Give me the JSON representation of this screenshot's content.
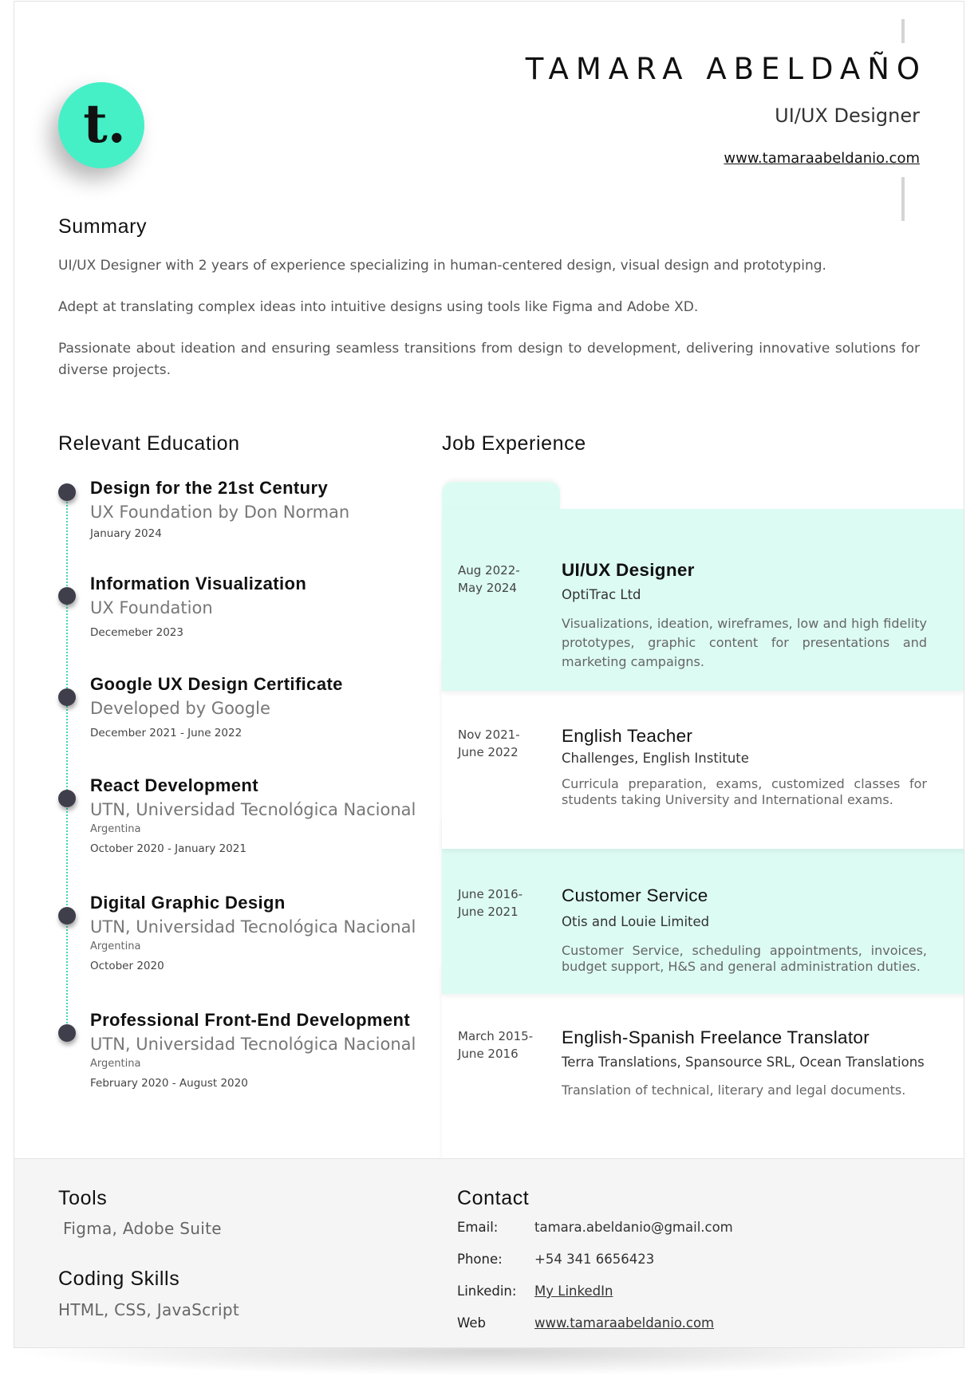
{
  "header": {
    "logo_letter": "t.",
    "name": "TAMARA ABELDAÑO",
    "role": "UI/UX Designer",
    "website": "www.tamaraabeldanio.com"
  },
  "summary": {
    "title": "Summary",
    "paragraphs": [
      "UI/UX Designer with 2 years of experience specializing in human-centered design, visual design and prototyping.",
      "Adept at translating complex ideas into intuitive designs using tools like Figma and Adobe XD.",
      "Passionate about ideation and ensuring seamless transitions from design to development, delivering innovative solutions for diverse projects."
    ]
  },
  "education": {
    "title": "Relevant Education",
    "items": [
      {
        "title": "Design for the 21st Century",
        "school": "UX Foundation by Don Norman",
        "location": "",
        "date": "January 2024"
      },
      {
        "title": "Information Visualization",
        "school": "UX Foundation",
        "location": "",
        "date": "Decemeber 2023"
      },
      {
        "title": "Google UX Design Certificate",
        "school": "Developed by Google",
        "location": "",
        "date": "December 2021 - June 2022"
      },
      {
        "title": "React Development",
        "school": "UTN, Universidad Tecnológica Nacional",
        "location": "Argentina",
        "date": "October 2020 - January 2021"
      },
      {
        "title": "Digital Graphic Design",
        "school": "UTN, Universidad Tecnológica Nacional",
        "location": "Argentina",
        "date": "October 2020"
      },
      {
        "title": "Professional Front-End Development",
        "school": "UTN, Universidad Tecnológica Nacional",
        "location": "Argentina",
        "date": "February 2020 - August 2020"
      }
    ]
  },
  "experience": {
    "title": "Job Experience",
    "items": [
      {
        "date_start": "Aug 2022-",
        "date_end": "May 2024",
        "title": "UI/UX Designer",
        "company": "OptiTrac Ltd",
        "description": "Visualizations, ideation, wireframes, low and high fidelity prototypes, graphic content for presentations and marketing campaigns."
      },
      {
        "date_start": "Nov 2021-",
        "date_end": "June 2022",
        "title": "English Teacher",
        "company": "Challenges, English Institute",
        "description": "Curricula preparation, exams, customized classes for students taking University and International exams."
      },
      {
        "date_start": "June 2016-",
        "date_end": "June 2021",
        "title": "Customer Service",
        "company": "Otis and Louie Limited",
        "description": "Customer Service, scheduling appointments, invoices, budget support, H&S and general administration duties."
      },
      {
        "date_start": "March 2015-",
        "date_end": "June 2016",
        "title": "English-Spanish Freelance Translator",
        "company": "Terra Translations, Spansource SRL, Ocean Translations",
        "description": "Translation of technical, literary and legal documents."
      }
    ]
  },
  "tools": {
    "title": "Tools",
    "value": "Figma, Adobe  Suite"
  },
  "coding": {
    "title": "Coding Skills",
    "value": "HTML, CSS, JavaScript"
  },
  "contact": {
    "title": "Contact",
    "email_label": "Email:",
    "email": "tamara.abeldanio@gmail.com",
    "phone_label": "Phone:",
    "phone": "+54 341 6656423",
    "linkedin_label": "Linkedin:",
    "linkedin": "My LinkedIn",
    "web_label": "Web",
    "web": "www.tamaraabeldanio.com"
  },
  "colors": {
    "accent": "#45f0c7",
    "mint_panel": "#dcfbf3",
    "timeline_dot": "#3e3f4b"
  }
}
